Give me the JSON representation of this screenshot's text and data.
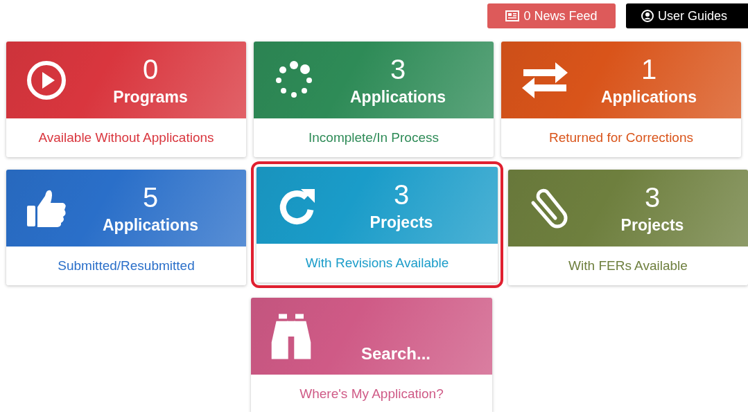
{
  "top_buttons": [
    {
      "kind": "news",
      "label": "0 News Feed"
    },
    {
      "kind": "guides",
      "label": "User Guides"
    }
  ],
  "rows": [
    [
      {
        "kind": "play",
        "count": "0",
        "title": "Programs",
        "subtitle": "Available Without Applications",
        "color": "#d9363e",
        "highlighted": false
      },
      {
        "kind": "spinner",
        "count": "3",
        "title": "Applications",
        "subtitle": "Incomplete/In Process",
        "color": "#2e8b57",
        "highlighted": false
      },
      {
        "kind": "arrows",
        "count": "1",
        "title": "Applications",
        "subtitle": "Returned for Corrections",
        "color": "#d9541a",
        "highlighted": false
      }
    ],
    [
      {
        "kind": "thumb",
        "count": "5",
        "title": "Applications",
        "subtitle": "Submitted/Resubmitted",
        "color": "#2a6fc9",
        "highlighted": false
      },
      {
        "kind": "refresh",
        "count": "3",
        "title": "Projects",
        "subtitle": "With Revisions Available",
        "color": "#1a9cc9",
        "highlighted": true
      },
      {
        "kind": "clip",
        "count": "3",
        "title": "Projects",
        "subtitle": "With FERs Available",
        "color": "#6e7f3e",
        "highlighted": false
      }
    ],
    [
      {
        "kind": "binoculars",
        "title": "Search...",
        "subtitle": "Where's My Application?",
        "color": "#cf5a86",
        "highlighted": false
      }
    ]
  ]
}
